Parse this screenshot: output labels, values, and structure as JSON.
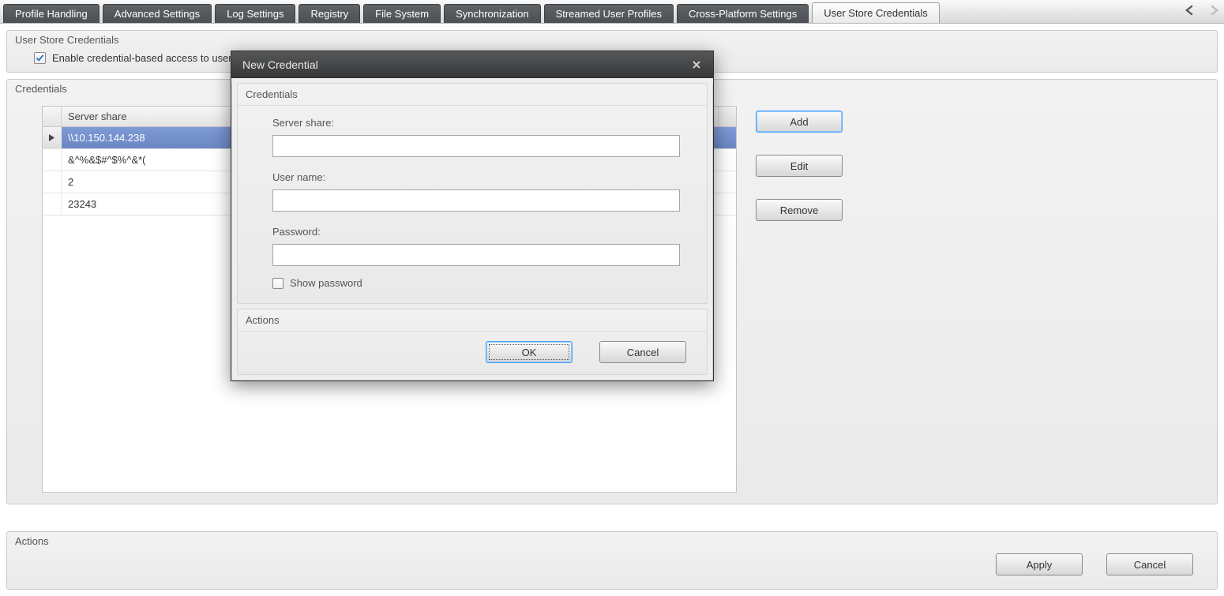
{
  "tabs": {
    "items": [
      "Profile Handling",
      "Advanced Settings",
      "Log Settings",
      "Registry",
      "File System",
      "Synchronization",
      "Streamed User Profiles",
      "Cross-Platform Settings",
      "User Store Credentials"
    ],
    "active_index": 8
  },
  "page": {
    "title": "User Store Credentials",
    "enable_checkbox_label": "Enable credential-based access to user store",
    "enable_checked": true
  },
  "credentials": {
    "section_title": "Credentials",
    "column_header": "Server share",
    "rows": [
      "\\\\10.150.144.238",
      "&^%&$#^$%^&*(",
      "2",
      "23243"
    ],
    "selected_index": 0,
    "buttons": {
      "add": "Add",
      "edit": "Edit",
      "remove": "Remove"
    }
  },
  "footer": {
    "section_title": "Actions",
    "apply": "Apply",
    "cancel": "Cancel"
  },
  "dialog": {
    "title": "New Credential",
    "credentials_section": "Credentials",
    "actions_section": "Actions",
    "fields": {
      "server_share": {
        "label": "Server share:",
        "value": ""
      },
      "user_name": {
        "label": "User name:",
        "value": ""
      },
      "password": {
        "label": "Password:",
        "value": ""
      }
    },
    "show_password_label": "Show password",
    "show_password_checked": false,
    "ok": "OK",
    "cancel": "Cancel"
  }
}
